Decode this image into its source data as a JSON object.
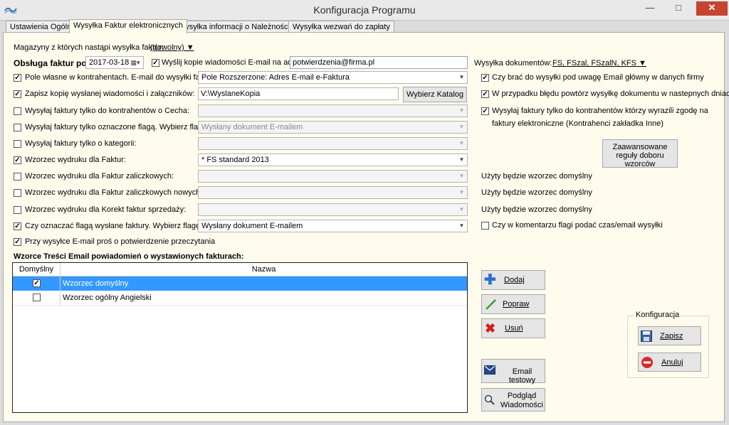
{
  "window": {
    "title": "Konfiguracja Programu",
    "minimize": "—",
    "maximize": "□",
    "close": "✕"
  },
  "tabs": [
    {
      "label": "Ustawienia Ogólne",
      "active": false
    },
    {
      "label": "Wysyłka Faktur elektronicznych",
      "active": true
    },
    {
      "label": "Wysyłka informacji o Należnościach",
      "active": false
    },
    {
      "label": "Wysyłka wezwań do zapłaty",
      "active": false
    }
  ],
  "form": {
    "warehouses_label": "Magazyny z których nastąpi wysyłka faktur:",
    "warehouses_value": "(dowolny) ▼",
    "invoices_from_label": "Obsługa faktur po:",
    "invoices_from_date": "2017-03-18",
    "send_copy_label": "Wyślij kopie wiadomości E-mail na adres:",
    "send_copy_checked": true,
    "send_copy_address": "potwierdzenia@firma.pl",
    "doc_types_label": "Wysyłka dokumentów:",
    "doc_types_value": "FS, FSzal, FSzalN, KFS ▼",
    "rows": [
      {
        "label": "Pole własne w kontrahentach. E-mail do wysyłki faktur:",
        "checked": true,
        "control": "combo",
        "value": "Pole Rozszerzone: Adres E-mail e-Faktura",
        "enabled": true
      },
      {
        "label": "Zapisz kopię wysłanej wiadomości i załączników:",
        "checked": true,
        "control": "text",
        "value": "V:\\WyslaneKopia",
        "enabled": true
      },
      {
        "label": "Wysyłaj faktury tylko do kontrahentów o Cecha:",
        "checked": false,
        "control": "combo",
        "value": "",
        "enabled": false
      },
      {
        "label": "Wysyłaj faktury tylko oznaczone flagą. Wybierz flagę:",
        "checked": false,
        "control": "combo",
        "value": "Wysłany dokument E-mailem",
        "enabled": false
      },
      {
        "label": "Wysyłaj faktury tylko o kategorii:",
        "checked": false,
        "control": "combo",
        "value": "",
        "enabled": false
      },
      {
        "label": "Wzorzec wydruku dla Faktur:",
        "checked": true,
        "control": "combo",
        "value": "* FS standard 2013",
        "enabled": true
      },
      {
        "label": "Wzorzec wydruku dla Faktur zaliczkowych:",
        "checked": false,
        "control": "combo",
        "value": "",
        "enabled": false
      },
      {
        "label": "Wzorzec wydruku dla Faktur zaliczkowych nowych:",
        "checked": false,
        "control": "combo",
        "value": "",
        "enabled": false
      },
      {
        "label": "Wzorzec wydruku dla Korekt faktur sprzedaży:",
        "checked": false,
        "control": "combo",
        "value": "",
        "enabled": false
      },
      {
        "label": "Czy oznaczać flagą wysłane faktury. Wybierz flagę:",
        "checked": true,
        "control": "combo",
        "value": "Wysłany dokument E-mailem",
        "enabled": true
      },
      {
        "label": "Przy wysyłce E-mail proś o potwierdzenie przeczytania",
        "checked": true,
        "control": "none",
        "value": "",
        "enabled": true
      }
    ],
    "choose_folder_button": "Wybierz Katalog",
    "default_template_note": "Użyty będzie wzorzec domyślny",
    "right_options": [
      {
        "label": "Czy brać do wysyłki pod uwagę Email główny w danych firmy",
        "checked": true
      },
      {
        "label": "W przypadku błędu powtórz wysyłkę dokumentu w nastepnych dniach",
        "checked": true
      },
      {
        "label": "Wysyłaj faktury tylko do kontrahentów którzy wyrazili zgodę na",
        "label2": "faktury elektroniczne (Kontrahenci zakładka Inne)",
        "checked": true
      }
    ],
    "advanced_rules_button": "Zaawansowane reguły doboru wzorców",
    "comment_flag_label": "Czy w komentarzu flagi podać czas/email wysyłki",
    "comment_flag_checked": false
  },
  "templates": {
    "section_title": "Wzorce Treści Email powiadomień o wystawionych fakturach:",
    "columns": [
      "Domyślny",
      "Nazwa"
    ],
    "rows": [
      {
        "default": true,
        "name": "Wzorzec domyślny",
        "selected": true
      },
      {
        "default": false,
        "name": "Wzorzec ogólny Angielski",
        "selected": false
      }
    ]
  },
  "actions": {
    "add": "Dodaj",
    "edit": "Popraw",
    "delete": "Usuń",
    "test_email": "Email testowy",
    "preview_line1": "Podgląd",
    "preview_line2": "Wiadomości"
  },
  "config_group": {
    "title": "Konfiguracja",
    "save": "Zapisz",
    "cancel": "Anuluj"
  },
  "colors": {
    "panel_bg": "#fffcee",
    "selection": "#3399ff",
    "close_button": "#c5452f"
  }
}
